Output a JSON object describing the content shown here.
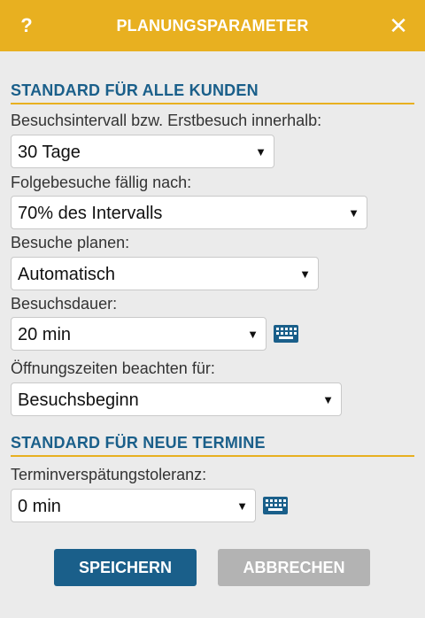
{
  "header": {
    "help_label": "?",
    "title": "PLANUNGSPARAMETER",
    "close_label": "✕"
  },
  "section_customers": {
    "heading": "STANDARD FÜR ALLE KUNDEN",
    "interval_label": "Besuchsintervall bzw. Erstbesuch innerhalb:",
    "interval_value": "30 Tage",
    "followup_label": "Folgebesuche fällig nach:",
    "followup_value": "70% des Intervalls",
    "plan_label": "Besuche planen:",
    "plan_value": "Automatisch",
    "duration_label": "Besuchsdauer:",
    "duration_value": "20 min",
    "hours_label": "Öffnungszeiten beachten für:",
    "hours_value": "Besuchsbeginn"
  },
  "section_appointments": {
    "heading": "STANDARD FÜR NEUE TERMINE",
    "tolerance_label": "Terminverspätungstoleranz:",
    "tolerance_value": "0 min"
  },
  "caret": "▼",
  "buttons": {
    "save": "SPEICHERN",
    "cancel": "ABBRECHEN"
  },
  "colors": {
    "header_bg": "#e8b020",
    "accent_blue": "#1a5f8a",
    "cancel_bg": "#b3b3b3",
    "panel_bg": "#ebebeb"
  },
  "icons": {
    "help": "help-icon",
    "close": "close-icon",
    "keyboard": "keyboard-icon"
  }
}
